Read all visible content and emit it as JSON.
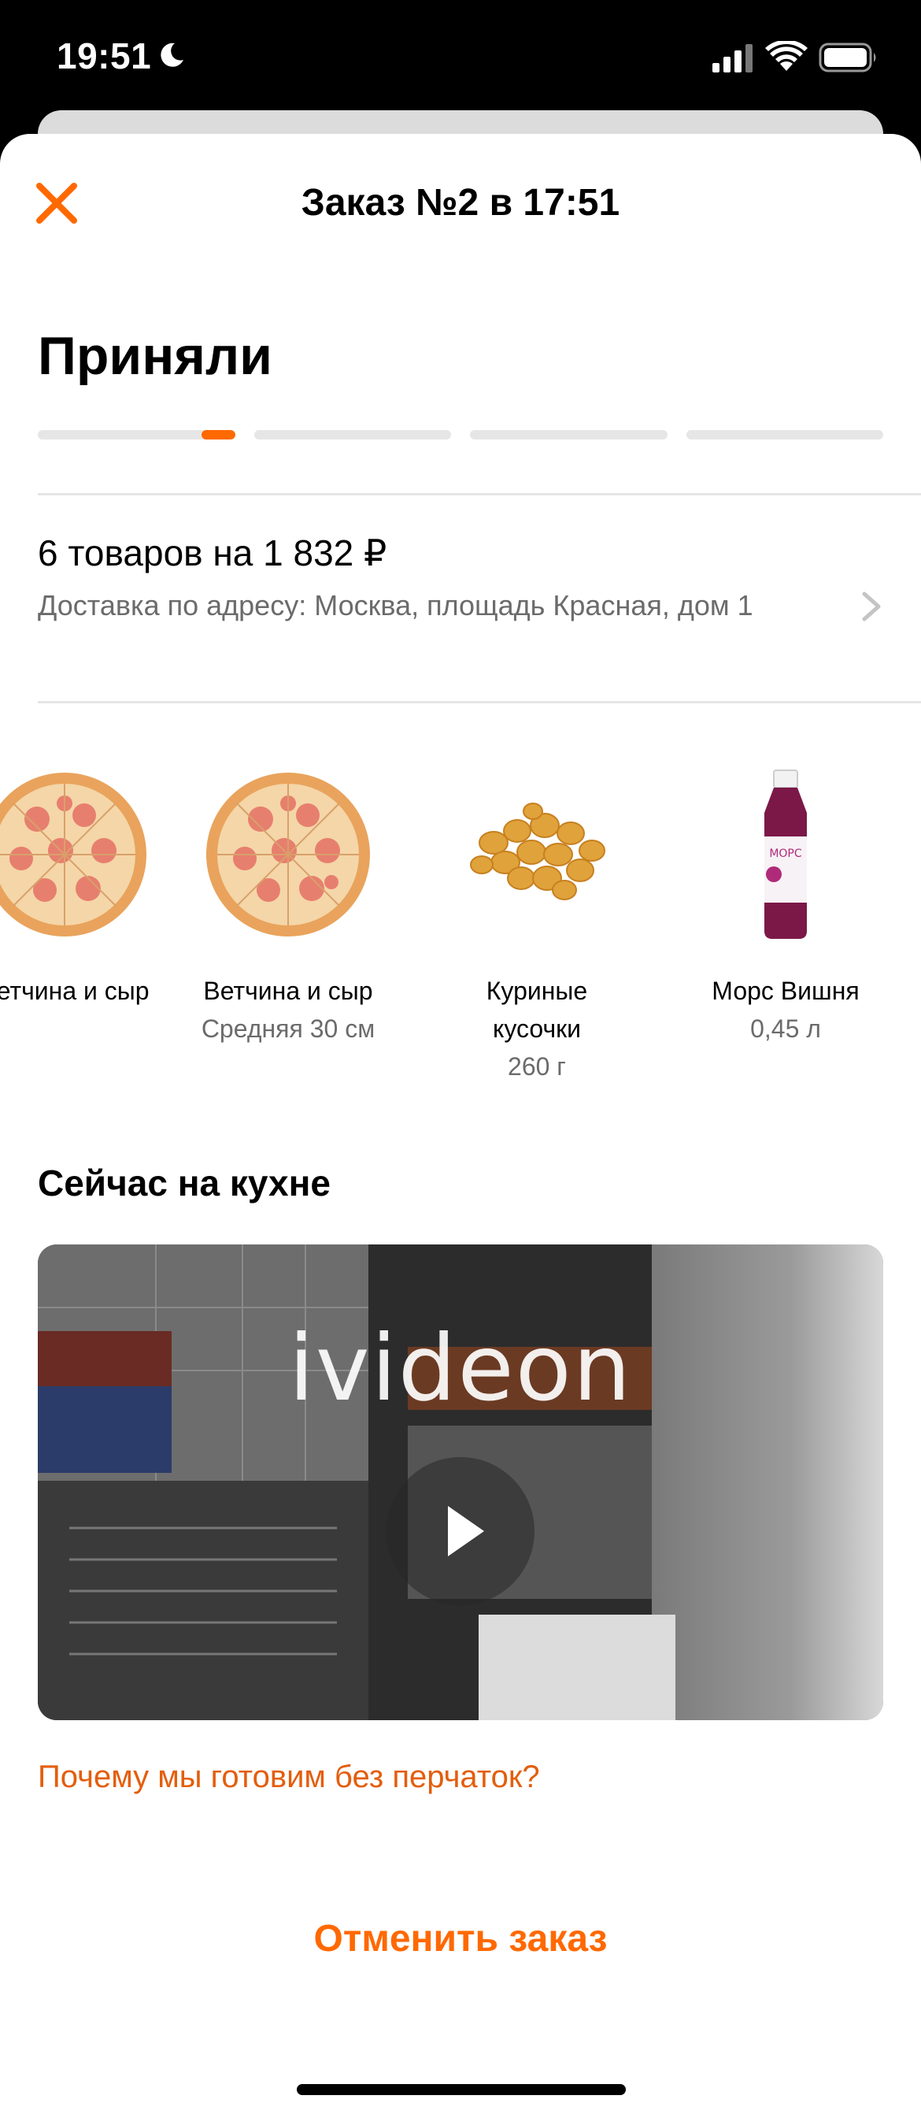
{
  "status_bar": {
    "time": "19:51",
    "icons": [
      "moon-icon",
      "signal-icon",
      "wifi-icon",
      "battery-icon"
    ]
  },
  "header": {
    "title": "Заказ №2 в 17:51",
    "close_icon": "close-icon"
  },
  "order_status": {
    "title": "Приняли",
    "steps_total": 4,
    "current_step": 1,
    "current_step_progress": 0.17
  },
  "summary": {
    "total": "6 товаров на 1 832 ₽",
    "address": "Доставка по адресу: Москва, площадь Красная, дом 1"
  },
  "products": [
    {
      "name": "Ветчина и сыр",
      "size": "",
      "image": "pizza"
    },
    {
      "name": "Ветчина и сыр",
      "size": "Средняя 30 см",
      "image": "pizza"
    },
    {
      "name": "Куриные кусочки",
      "size": "260 г",
      "image": "chicken-nuggets"
    },
    {
      "name": "Морс Вишня",
      "size": "0,45 л",
      "image": "juice-bottle"
    }
  ],
  "kitchen": {
    "title": "Сейчас на кухне",
    "video_brand": "ivideon",
    "gloves_link": "Почему мы готовим без перчаток?"
  },
  "actions": {
    "cancel": "Отменить заказ"
  },
  "colors": {
    "accent": "#ff6900",
    "link": "#e35e0c",
    "secondary_text": "#6b6b6b",
    "divider": "#e6e6e6"
  }
}
